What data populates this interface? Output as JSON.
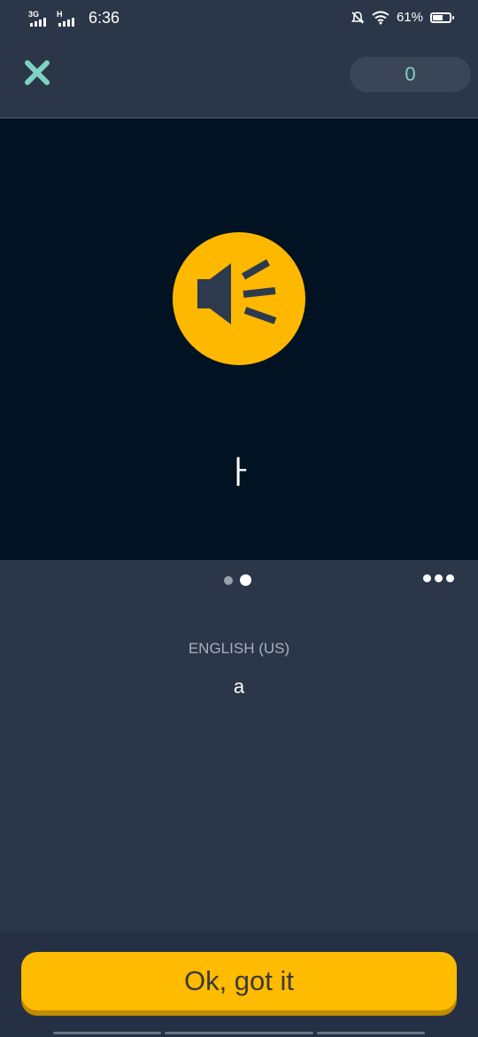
{
  "status_bar": {
    "network1": "3G",
    "network2": "H",
    "time": "6:36",
    "battery_percent": "61%",
    "battery_level": 0.61
  },
  "header": {
    "score": "0"
  },
  "card": {
    "character": "ㅏ",
    "page_dots": {
      "count": 2,
      "active_index": 1
    }
  },
  "translation": {
    "language_label": "ENGLISH (US)",
    "text": "a"
  },
  "footer": {
    "ok_label": "Ok, got it"
  },
  "colors": {
    "accent": "#ffb800",
    "close_icon": "#7fd3c0",
    "card_bg": "#011222",
    "panel_bg": "#2b3648"
  },
  "icons": [
    "close-icon",
    "speaker-icon",
    "more-options-icon",
    "wifi-icon",
    "mute-icon",
    "battery-icon"
  ]
}
